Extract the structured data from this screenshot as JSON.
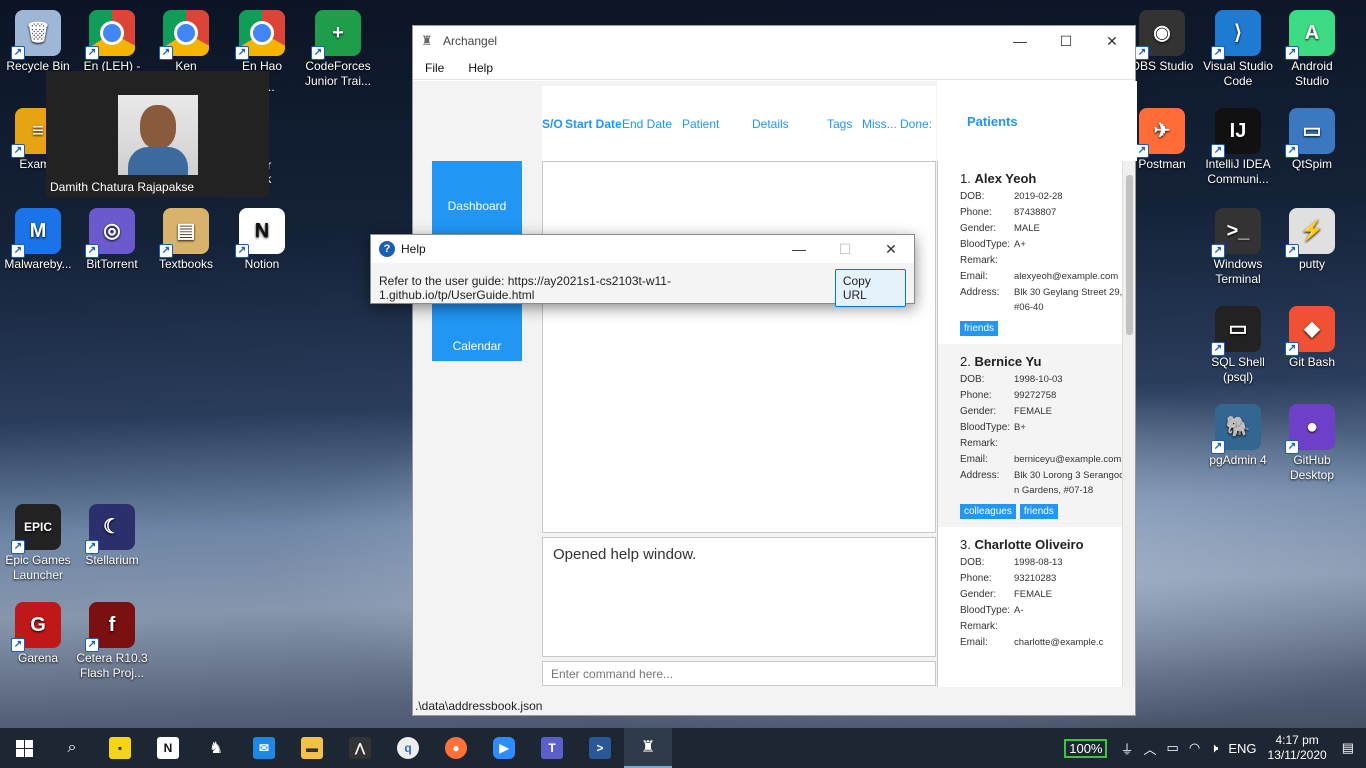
{
  "desktop": {
    "icons_left": [
      {
        "label": "Recycle Bin",
        "color": "#9fb7d6",
        "glyph": "🗑"
      },
      {
        "label": "En (LEH) -",
        "color": "chrome",
        "glyph": ""
      },
      {
        "label": "Ken",
        "color": "chrome",
        "glyph": ""
      },
      {
        "label": "En Hao",
        "color": "chrome",
        "glyph": ""
      },
      {
        "label": "CodeForces Junior Trai...",
        "color": "#1e9e4a",
        "glyph": "+"
      },
      {
        "label": "Examp",
        "color": "#e8a313",
        "glyph": "≡"
      },
      {
        "label": "Malwareby...",
        "color": "#1a73e8",
        "glyph": "M"
      },
      {
        "label": "BitTorrent",
        "color": "#6a5acd",
        "glyph": "◎"
      },
      {
        "label": "Textbooks",
        "color": "#d9b36b",
        "glyph": "▤"
      },
      {
        "label": "Notion",
        "color": "#ffffff",
        "glyph": "N"
      },
      {
        "label": "Epic Games Launcher",
        "color": "#222222",
        "glyph": "EPIC"
      },
      {
        "label": "Stellarium",
        "color": "#2b2f6b",
        "glyph": "☾"
      },
      {
        "label": "Garena",
        "color": "#c01818",
        "glyph": "G"
      },
      {
        "label": "Cetera R10.3 Flash Proj...",
        "color": "#7a1010",
        "glyph": "f"
      }
    ],
    "icon_partial_labels": [
      "o..le...",
      "mber",
      "ilk"
    ],
    "icons_right": [
      {
        "label": "OBS Studio",
        "color": "#333333",
        "glyph": "◉"
      },
      {
        "label": "Visual Studio Code",
        "color": "#1f7ad1",
        "glyph": "⟩"
      },
      {
        "label": "Android Studio",
        "color": "#3ddc84",
        "glyph": "A"
      },
      {
        "label": "Postman",
        "color": "#ff6c37",
        "glyph": "✈"
      },
      {
        "label": "IntelliJ IDEA Communi...",
        "color": "#111111",
        "glyph": "IJ"
      },
      {
        "label": "QtSpim",
        "color": "#3a78c2",
        "glyph": "▭"
      },
      {
        "label": "Windows Terminal",
        "color": "#333333",
        "glyph": ">_"
      },
      {
        "label": "putty",
        "color": "#e0e0e0",
        "glyph": "⚡"
      },
      {
        "label": "SQL Shell (psql)",
        "color": "#222222",
        "glyph": "▭"
      },
      {
        "label": "Git Bash",
        "color": "#f05033",
        "glyph": "◆"
      },
      {
        "label": "pgAdmin 4",
        "color": "#336791",
        "glyph": "🐘"
      },
      {
        "label": "GitHub Desktop",
        "color": "#6e40c9",
        "glyph": "●"
      }
    ]
  },
  "video": {
    "name": "Damith Chatura Rajapakse"
  },
  "app": {
    "title": "Archangel",
    "menu": {
      "file": "File",
      "help": "Help"
    },
    "nav": {
      "dashboard": "Dashboard",
      "calendar": "Calendar"
    },
    "columns": [
      "S/O",
      "Start Date",
      "End Date",
      "Patient",
      "Details",
      "Tags",
      "Miss...",
      "Done:"
    ],
    "patients_title": "Patients",
    "result": "Opened help window.",
    "command_placeholder": "Enter command here...",
    "status": ".\\data\\addressbook.json",
    "field_labels": {
      "dob": "DOB:",
      "phone": "Phone:",
      "gender": "Gender:",
      "bloodtype": "BloodType:",
      "remark": "Remark:",
      "email": "Email:",
      "address": "Address:"
    },
    "patients": [
      {
        "index": "1.",
        "name": "Alex Yeoh",
        "dob": "2019-02-28",
        "phone": "87438807",
        "gender": "MALE",
        "bloodtype": "A+",
        "remark": "",
        "email": "alexyeoh@example.com",
        "address": "Blk 30 Geylang Street 29, #06-40",
        "tags": [
          "friends"
        ]
      },
      {
        "index": "2.",
        "name": "Bernice Yu",
        "dob": "1998-10-03",
        "phone": "99272758",
        "gender": "FEMALE",
        "bloodtype": "B+",
        "remark": "",
        "email": "berniceyu@example.com",
        "address": "Blk 30 Lorong 3 Serangoon Gardens, #07-18",
        "tags": [
          "colleagues",
          "friends"
        ]
      },
      {
        "index": "3.",
        "name": "Charlotte Oliveiro",
        "dob": "1998-08-13",
        "phone": "93210283",
        "gender": "FEMALE",
        "bloodtype": "A-",
        "remark": "",
        "email": "charlotte@example.c",
        "address": "",
        "tags": []
      }
    ]
  },
  "help_dialog": {
    "title": "Help",
    "message": "Refer to the user guide: https://ay2021s1-cs2103t-w11-1.github.io/tp/UserGuide.html",
    "copy_button": "Copy URL"
  },
  "taskbar": {
    "battery": "100%",
    "language": "ENG",
    "time": "4:17 pm",
    "date": "13/11/2020"
  }
}
